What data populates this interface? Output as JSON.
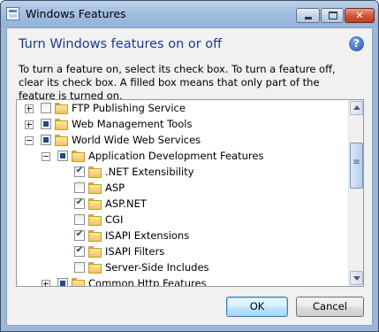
{
  "window": {
    "title": "Windows Features"
  },
  "heading": "Turn Windows features on or off",
  "help_glyph": "?",
  "description": "To turn a feature on, select its check box. To turn a feature off, clear its check box. A filled box means that only part of the feature is turned on.",
  "features": [
    {
      "label": "FTP Publishing Service",
      "level": 0,
      "expander": "plus",
      "state": "unchecked"
    },
    {
      "label": "Web Management Tools",
      "level": 0,
      "expander": "plus",
      "state": "partial"
    },
    {
      "label": "World Wide Web Services",
      "level": 0,
      "expander": "minus",
      "state": "partial"
    },
    {
      "label": "Application Development Features",
      "level": 1,
      "expander": "minus",
      "state": "partial"
    },
    {
      "label": ".NET Extensibility",
      "level": 2,
      "expander": "none",
      "state": "checked"
    },
    {
      "label": "ASP",
      "level": 2,
      "expander": "none",
      "state": "unchecked"
    },
    {
      "label": "ASP.NET",
      "level": 2,
      "expander": "none",
      "state": "checked"
    },
    {
      "label": "CGI",
      "level": 2,
      "expander": "none",
      "state": "unchecked"
    },
    {
      "label": "ISAPI Extensions",
      "level": 2,
      "expander": "none",
      "state": "checked"
    },
    {
      "label": "ISAPI Filters",
      "level": 2,
      "expander": "none",
      "state": "checked"
    },
    {
      "label": "Server-Side Includes",
      "level": 2,
      "expander": "none",
      "state": "unchecked"
    },
    {
      "label": "Common Http Features",
      "level": 1,
      "expander": "plus",
      "state": "partial"
    }
  ],
  "buttons": {
    "ok": "OK",
    "cancel": "Cancel"
  }
}
